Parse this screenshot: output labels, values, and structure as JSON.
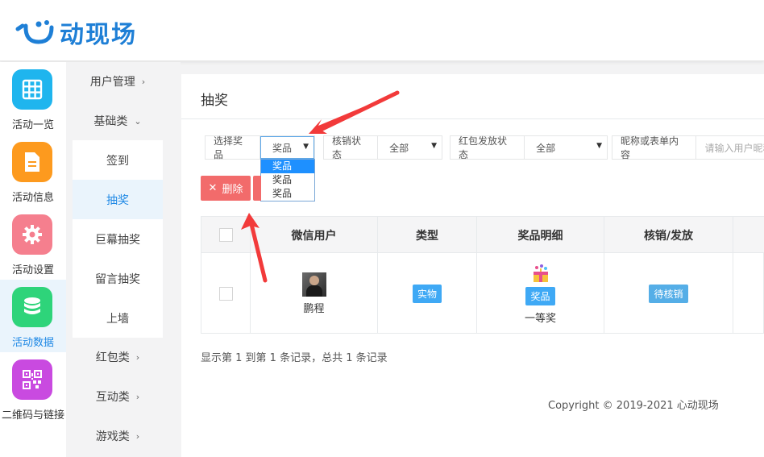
{
  "app": {
    "brand": "动现场",
    "brand_color": "#1e7fd6"
  },
  "leftnav": [
    {
      "label": "活动一览",
      "icon": "grid-icon",
      "color": "#1fb5ee"
    },
    {
      "label": "活动信息",
      "icon": "document-icon",
      "color": "#fd9a1e"
    },
    {
      "label": "活动设置",
      "icon": "gear-icon",
      "color": "#f57f8e"
    },
    {
      "label": "活动数据",
      "icon": "database-icon",
      "color": "#2ed47a",
      "active": true
    },
    {
      "label": "二维码与链接",
      "icon": "qrcode-icon",
      "color": "#c94ae0"
    }
  ],
  "subnav": {
    "user_mgmt": "用户管理",
    "basic": "基础类",
    "children": [
      "签到",
      "抽奖",
      "巨幕抽奖",
      "留言抽奖",
      "上墙"
    ],
    "active_child": "抽奖",
    "redpacket": "红包类",
    "interactive": "互动类",
    "game": "游戏类"
  },
  "main": {
    "title": "抽奖",
    "filters": {
      "prize_label": "选择奖品",
      "prize_value": "奖品",
      "verify_label": "核销状态",
      "verify_value": "全部",
      "redpacket_label": "红包发放状态",
      "redpacket_value": "全部",
      "search_label": "昵称或表单内容",
      "search_placeholder": "请输入用户昵称"
    },
    "dropdown_options": [
      "奖品",
      "奖品",
      "奖品"
    ],
    "delete_button": "删除",
    "table": {
      "headers": [
        "微信用户",
        "类型",
        "奖品明细",
        "核销/发放"
      ],
      "rows": [
        {
          "user": "鹏程",
          "type": "实物",
          "prize_tag": "奖品",
          "prize_name": "一等奖",
          "status": "待核销"
        }
      ]
    },
    "summary": "显示第 1 到第 1 条记录，总共 1 条记录",
    "copyright": "Copyright © 2019-2021 心动现场"
  },
  "colors": {
    "delete": "#f26b6b",
    "tag": "#3fa9f5",
    "arrow": "#f23a3a",
    "active_text": "#1e88e5"
  }
}
